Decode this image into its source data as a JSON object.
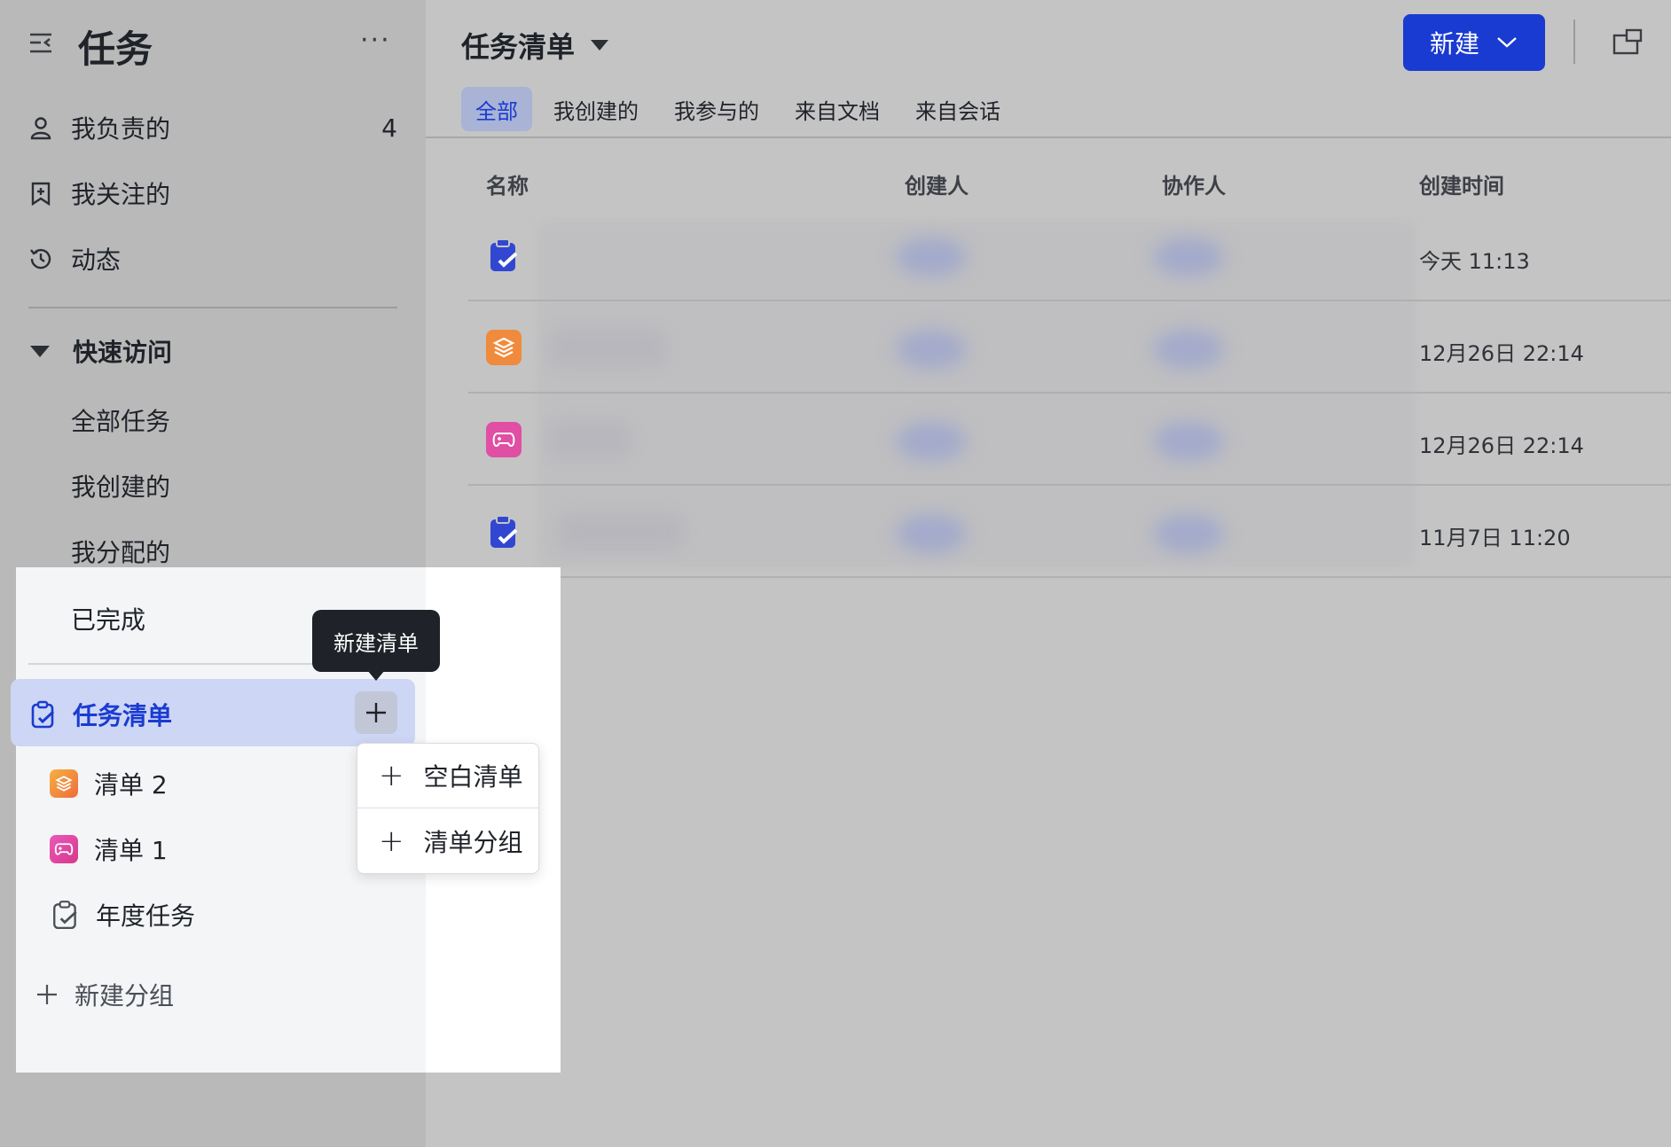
{
  "sidebar": {
    "title": "任务",
    "items": [
      {
        "label": "我负责的",
        "count": "4",
        "icon": "person-icon"
      },
      {
        "label": "我关注的",
        "icon": "bookmark-icon"
      },
      {
        "label": "动态",
        "icon": "history-icon"
      }
    ],
    "quick_access": {
      "label": "快速访问",
      "items": [
        "全部任务",
        "我创建的",
        "我分配的",
        "已完成"
      ]
    },
    "task_lists": {
      "label": "任务清单",
      "tooltip": "新建清单",
      "items": [
        {
          "label": "清单 2",
          "icon": "layers-icon",
          "color": "#f08a3c"
        },
        {
          "label": "清单 1",
          "icon": "gamepad-icon",
          "color": "#e04fa3"
        },
        {
          "label": "年度任务",
          "icon": "clipboard-check-icon"
        }
      ]
    },
    "new_group": "新建分组"
  },
  "dropdown": {
    "items": [
      "空白清单",
      "清单分组"
    ]
  },
  "header": {
    "title": "任务清单",
    "new_button": "新建"
  },
  "tabs": [
    "全部",
    "我创建的",
    "我参与的",
    "来自文档",
    "来自会话"
  ],
  "table": {
    "columns": [
      "名称",
      "创建人",
      "协作人",
      "创建时间"
    ],
    "rows": [
      {
        "icon": "clipboard-check-icon",
        "time": "今天 11:13"
      },
      {
        "icon": "layers-icon",
        "time": "12月26日 22:14"
      },
      {
        "icon": "gamepad-icon",
        "time": "12月26日 22:14"
      },
      {
        "icon": "clipboard-check-icon",
        "time": "11月7日 11:20"
      }
    ]
  },
  "colors": {
    "accent": "#1a3bd1",
    "highlight": "#cdd6f4",
    "orange": "#f08a3c",
    "pink": "#e04fa3"
  }
}
